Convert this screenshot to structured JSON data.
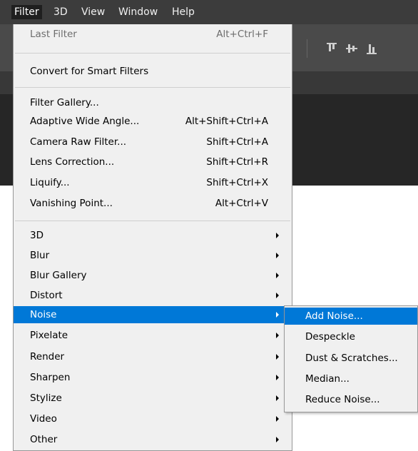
{
  "menubar": {
    "items": [
      {
        "label": "Filter"
      },
      {
        "label": "3D"
      },
      {
        "label": "View"
      },
      {
        "label": "Window"
      },
      {
        "label": "Help"
      }
    ]
  },
  "toolbar_icons": [
    "align-top-icon",
    "align-vertical-center-icon",
    "align-bottom-icon"
  ],
  "filter_menu": {
    "last_filter": {
      "label": "Last Filter",
      "shortcut": "Alt+Ctrl+F"
    },
    "convert_smart": {
      "label": "Convert for Smart Filters"
    },
    "filter_gallery": {
      "label": "Filter Gallery..."
    },
    "adaptive_wide_angle": {
      "label": "Adaptive Wide Angle...",
      "shortcut": "Alt+Shift+Ctrl+A"
    },
    "camera_raw": {
      "label": "Camera Raw Filter...",
      "shortcut": "Shift+Ctrl+A"
    },
    "lens_correction": {
      "label": "Lens Correction...",
      "shortcut": "Shift+Ctrl+R"
    },
    "liquify": {
      "label": "Liquify...",
      "shortcut": "Shift+Ctrl+X"
    },
    "vanishing_point": {
      "label": "Vanishing Point...",
      "shortcut": "Alt+Ctrl+V"
    },
    "groups": [
      {
        "label": "3D"
      },
      {
        "label": "Blur"
      },
      {
        "label": "Blur Gallery"
      },
      {
        "label": "Distort"
      },
      {
        "label": "Noise"
      },
      {
        "label": "Pixelate"
      },
      {
        "label": "Render"
      },
      {
        "label": "Sharpen"
      },
      {
        "label": "Stylize"
      },
      {
        "label": "Video"
      },
      {
        "label": "Other"
      }
    ]
  },
  "noise_submenu": {
    "items": [
      {
        "label": "Add Noise..."
      },
      {
        "label": "Despeckle"
      },
      {
        "label": "Dust & Scratches..."
      },
      {
        "label": "Median..."
      },
      {
        "label": "Reduce Noise..."
      }
    ]
  },
  "colors": {
    "menubar_bg": "#3c3c3c",
    "menu_bg": "#f0f0f0",
    "highlight": "#0078d7",
    "disabled_text": "#6d6d6d"
  }
}
